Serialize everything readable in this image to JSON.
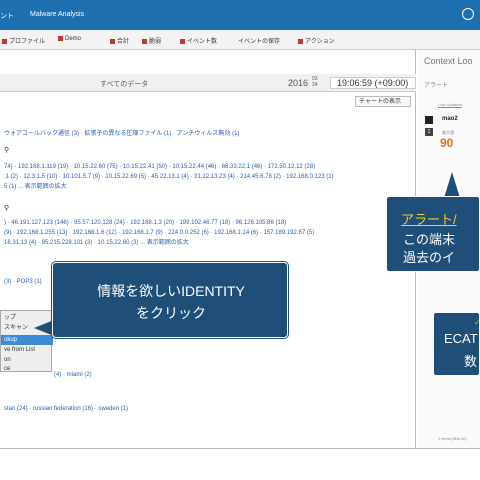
{
  "titlebar": {
    "left_text": "ント",
    "app_title": "Malware Analysis"
  },
  "tabs": [
    "プロファイル",
    "Demo",
    "合計",
    "脆弱",
    "イベント数",
    "イベントの保存",
    "アクション"
  ],
  "datahead": {
    "all_data": "すべてのデータ",
    "year": "2016",
    "month_day": [
      "03",
      "24"
    ],
    "time": "19:06:59 (+09:00)"
  },
  "chart_button": "チャートの表示",
  "lines": [
    "ウォアコールバック通信 (3) · 拡張子の異なる圧縮ファイル (1) · アンチウィルス無効 (1)",
    "74) · 192.168.1.119 (19) · 10.15.22.60 (75) · 10.15.22.41 (50) · 10.15.22.44 (46) · 66.33.22.1 (46) · 172.50.12.12 (28)",
    ".1 (2) · 12.3.1.5 (10) · 10.101.5.7 (9) · 10.15.22.69 (5) · 45.22.13.1 (4) · 31.12.13.23 (4) · 214.45.6.78 (2) · 192.168.0.123 (1)",
    "5 (1) ... 表示範囲の拡大",
    ") · 46.191.127.123 (146) · 95.57.120.128 (24) · 192.168.1.3 (20) · 199.102.46.77 (18) · 96.126.105.86 (18)",
    "(9) · 192.168.1.255 (13) · 192.168.1.6 (12) · 192.168.1.7 (9) · 224.0.0.252 (6) · 192.168.1.14 (6) · 157.189.192.67 (5)",
    "16.31.13 (4) · 95.215.228.101 (3) · 10.15.22.60 (3) ... 表示範囲の拡大",
    "(3) · POP3 (1)",
    "(4) · miami (2)",
    "stan (24) · russian federation (16) · sweden (1)"
  ],
  "context_menu": [
    "ップ",
    "スキャン",
    "okup",
    "ve from List",
    "on",
    "ce"
  ],
  "callout": {
    "line1": "情報を欲しいIDENTITY",
    "line2": "をクリック"
  },
  "right_panel": {
    "title": "Context Loo",
    "sub": "アラート",
    "updated": "Last Updated",
    "name": "mao2",
    "score_label": "最大値",
    "score": "90",
    "count": "1",
    "footer": "1 items (first 10)"
  },
  "box1": {
    "link": "アラート/",
    "line1": "この端末",
    "line2": "過去のイ"
  },
  "box2": {
    "line1": "ECAT",
    "line2": "数"
  }
}
